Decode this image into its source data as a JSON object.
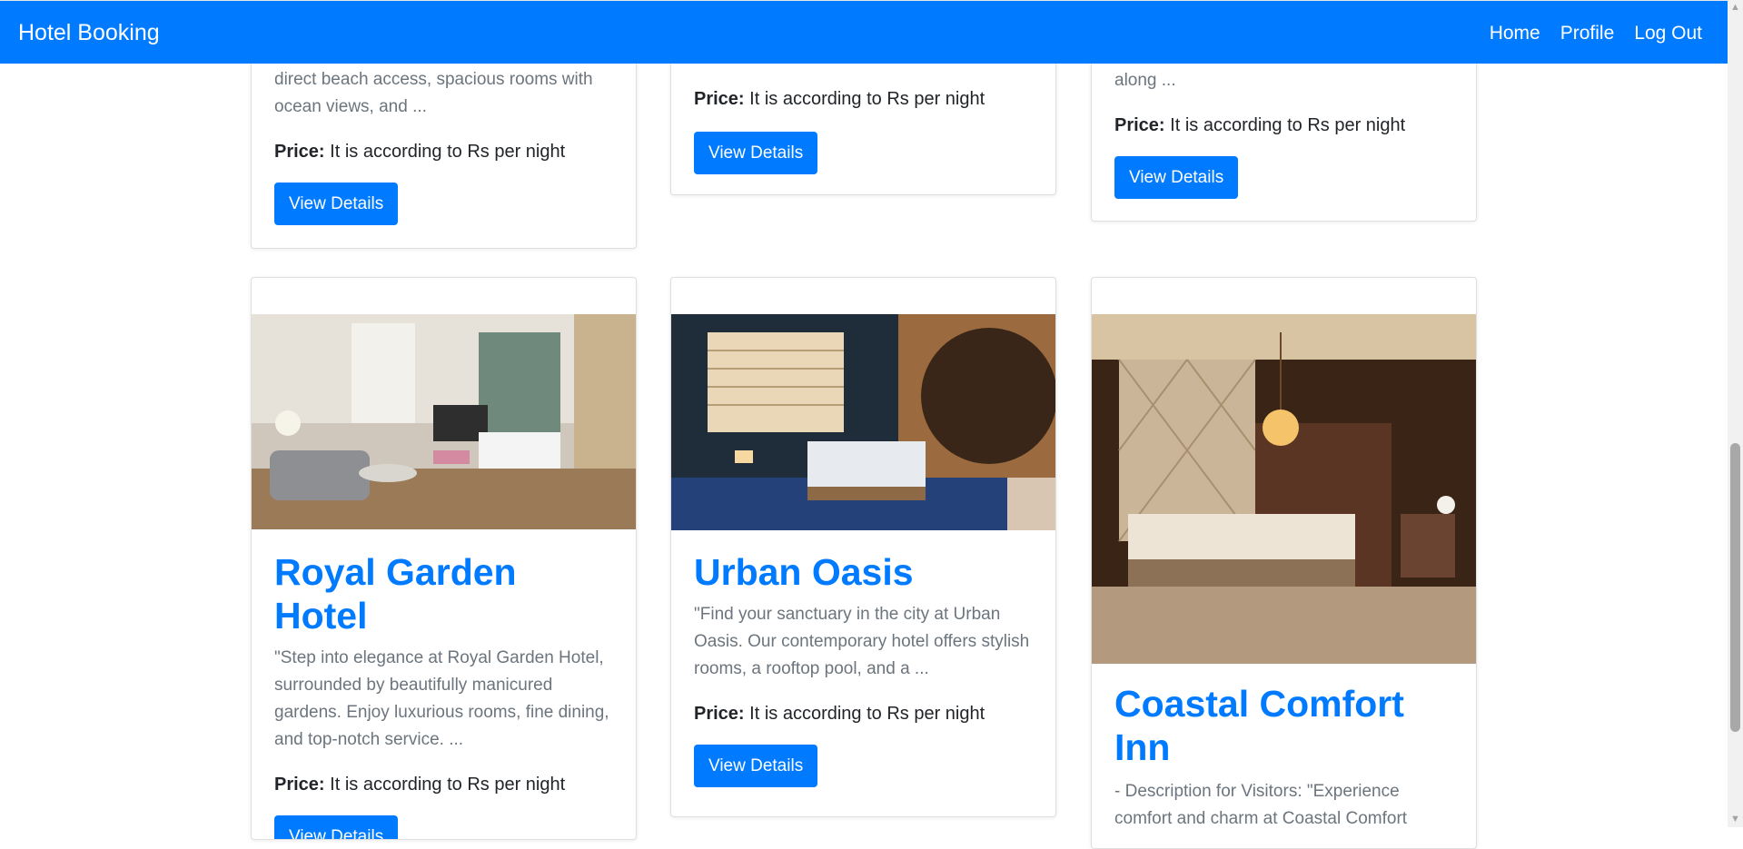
{
  "navbar": {
    "brand": "Hotel Booking",
    "links": [
      "Home",
      "Profile",
      "Log Out"
    ]
  },
  "common": {
    "price_label": "Price:",
    "price_text": "It is according to Rs per night",
    "button_label": "View Details"
  },
  "top_cards": [
    {
      "desc_tail": "direct beach access, spacious rooms with ocean views, and ..."
    },
    {
      "desc_tail": ""
    },
    {
      "desc_tail": "along ..."
    }
  ],
  "bottom_cards": [
    {
      "title": "Royal Garden Hotel",
      "description": "\"Step into elegance at Royal Garden Hotel, surrounded by beautifully manicured gardens. Enjoy luxurious rooms, fine dining, and top-notch service. ..."
    },
    {
      "title": "Urban Oasis",
      "description": "\"Find your sanctuary in the city at Urban Oasis. Our contemporary hotel offers stylish rooms, a rooftop pool, and a ..."
    },
    {
      "title": "Coastal Comfort Inn",
      "description": "- Description for Visitors: \"Experience comfort and charm at Coastal Comfort"
    }
  ],
  "colors": {
    "primary": "#007bff",
    "muted_text": "#6c757d",
    "body_text": "#212529"
  },
  "icons": {
    "scroll_up": "scroll-up-arrow-icon",
    "scroll_down": "scroll-down-arrow-icon"
  }
}
